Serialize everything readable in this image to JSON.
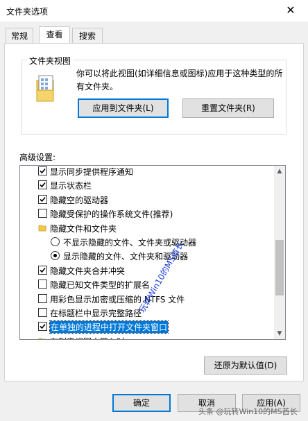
{
  "window": {
    "title": "文件夹选项",
    "close_symbol": "✕"
  },
  "tabs": [
    {
      "label": "常规",
      "active": false
    },
    {
      "label": "查看",
      "active": true
    },
    {
      "label": "搜索",
      "active": false
    }
  ],
  "folder_view": {
    "group_label": "文件夹视图",
    "description": "你可以将此视图(如详细信息或图标)应用于这种类型的所有文件夹。",
    "apply_button": "应用到文件夹(L)",
    "reset_button": "重置文件夹(R)"
  },
  "advanced": {
    "label": "高级设置:",
    "items": [
      {
        "type": "checkbox",
        "checked": true,
        "label": "显示同步提供程序通知"
      },
      {
        "type": "checkbox",
        "checked": true,
        "label": "显示状态栏"
      },
      {
        "type": "checkbox",
        "checked": true,
        "label": "隐藏空的驱动器"
      },
      {
        "type": "checkbox",
        "checked": false,
        "label": "隐藏受保护的操作系统文件(推荐)"
      },
      {
        "type": "folder",
        "label": "隐藏文件和文件夹"
      },
      {
        "type": "radio",
        "checked": false,
        "label": "不显示隐藏的文件、文件夹或驱动器"
      },
      {
        "type": "radio",
        "checked": true,
        "label": "显示隐藏的文件、文件夹和驱动器"
      },
      {
        "type": "checkbox",
        "checked": true,
        "label": "隐藏文件夹合并冲突"
      },
      {
        "type": "checkbox",
        "checked": false,
        "label": "隐藏已知文件类型的扩展名"
      },
      {
        "type": "checkbox",
        "checked": false,
        "label": "用彩色显示加密或压缩的 NTFS 文件"
      },
      {
        "type": "checkbox",
        "checked": false,
        "label": "在标题栏中显示完整路径"
      },
      {
        "type": "checkbox",
        "checked": true,
        "label": "在单独的进程中打开文件夹窗口",
        "selected": true
      },
      {
        "type": "folder",
        "label": "在列表视图中键入时"
      }
    ],
    "restore_button": "还原为默认值(D)"
  },
  "footer": {
    "ok": "确定",
    "cancel": "取消",
    "apply": "应用(A)"
  },
  "watermark": {
    "vertical": "玩转Win10的MS酋长",
    "bottom": "头条 @玩转Win10的MS酋长"
  },
  "colors": {
    "selection": "#0078d7",
    "folder_yellow": "#f2c94c",
    "watermark_blue": "#1a3fd6"
  }
}
